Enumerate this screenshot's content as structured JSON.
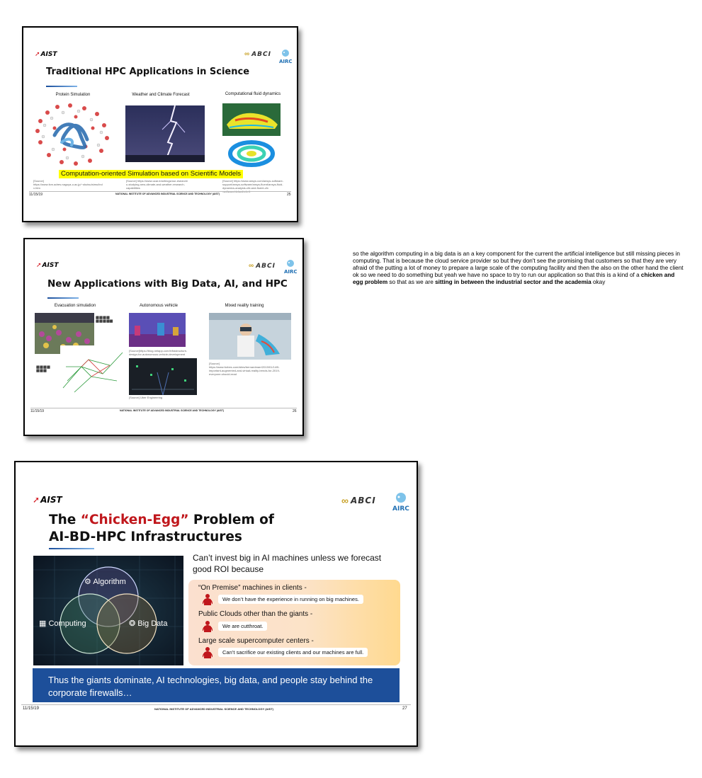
{
  "slide1": {
    "brand": "AIST",
    "abci": "ABCI",
    "airc": "AIRC",
    "title": "Traditional HPC Applications in Science",
    "captions": [
      "Protein Simulation",
      "Weather and Climate Forecast",
      "Computational fluid dynamics"
    ],
    "banner": "Computation-oriented Simulation based on Scientific Models",
    "sources": [
      "[Source]\nhttps://www.fcm.adres.nagoya-u.ac.jp/~okutsu/simu/ind\nx.htm",
      "[Source] https://www.ucar.edu/blogs/our-esearch/\nu-studying-new-climate-and-weather-research-\ncapabilities",
      "[Source] https://www.ansys.com/ansys-software-\nsupport/ansys-software/ansys-fluent/ansys-fluid-\ndynamics-analysis-cfd-and-fluent-cfx\n-software/default.cfx-1"
    ],
    "date": "11/15/19",
    "footer": "NATIONAL INSTITUTE OF ADVANCED INDUSTRIAL SCIENCE AND TECHNOLOGY (AIST)",
    "page": "25"
  },
  "slide2": {
    "brand": "AIST",
    "abci": "ABCI",
    "airc": "AIRC",
    "title": "New Applications with Big Data, AI, and HPC",
    "captions": [
      "Evacuation simulation",
      "Autonomous vehicle",
      "Mixed reality training"
    ],
    "sources": [
      "[Source]https://blog.netapp.com/infrastructure-\ndesign-for-autonomous-vehicle-development",
      "[Source]\nhttps://www.forbes.com/sites/bernardmarr/2019/01/14/5-\nimportant-augmented-and-virtual-reality-trends-for-2019-\neveryone-should-read",
      "[Source] Uber Engineering"
    ],
    "date": "11/15/19",
    "footer": "NATIONAL INSTITUTE OF ADVANCED INDUSTRIAL SCIENCE AND TECHNOLOGY (AIST)",
    "page": "26"
  },
  "notes": {
    "text1": "so the algorithm computing in a big data is an a key component for the current the artificial intelligence but still missing pieces in computing.  That is because the cloud service provider so but they don't see the promising that customers so that they are very afraid of the putting a lot of money to prepare a large scale of the computing facility and then the also on the other hand the client ok so we need to do something but yeah we have no space to try to run our application so that this is a kind of a",
    "bold1": "chicken and egg problem",
    "text2": "so that as we are",
    "bold2": "sitting in between the industrial sector and the academia",
    "text3": "okay"
  },
  "slide3": {
    "brand": "AIST",
    "abci": "ABCI",
    "airc": "AIRC",
    "title_pre": "The ",
    "title_highlight": "“Chicken-Egg”",
    "title_post": " Problem of",
    "title_line2": "AI-BD-HPC Infrastructures",
    "venn": {
      "top": "Algorithm",
      "left": "Computing",
      "right": "Big Data"
    },
    "lead": "Can’t invest big in AI machines unless we forecast good ROI because",
    "items": [
      {
        "heading": "“On Premise” machines in clients -",
        "quote": "We don’t have the experience in running on big machines."
      },
      {
        "heading": "Public Clouds other than the giants -",
        "quote": "We are cutthroat."
      },
      {
        "heading": "Large scale supercomputer centers -",
        "quote": "Can’t sacrifice our existing clients and our machines are full."
      }
    ],
    "conclusion": "Thus the giants dominate, AI technologies, big data, and people stay behind the corporate firewalls…",
    "date": "11/15/19",
    "footer": "NATIONAL INSTITUTE OF ADVANCED INDUSTRIAL SCIENCE AND TECHNOLOGY (AIST)",
    "page": "27"
  },
  "colors": {
    "accent_red": "#c0171c",
    "highlight_yellow": "#ffff00",
    "bar_blue": "#1d4f9a"
  }
}
